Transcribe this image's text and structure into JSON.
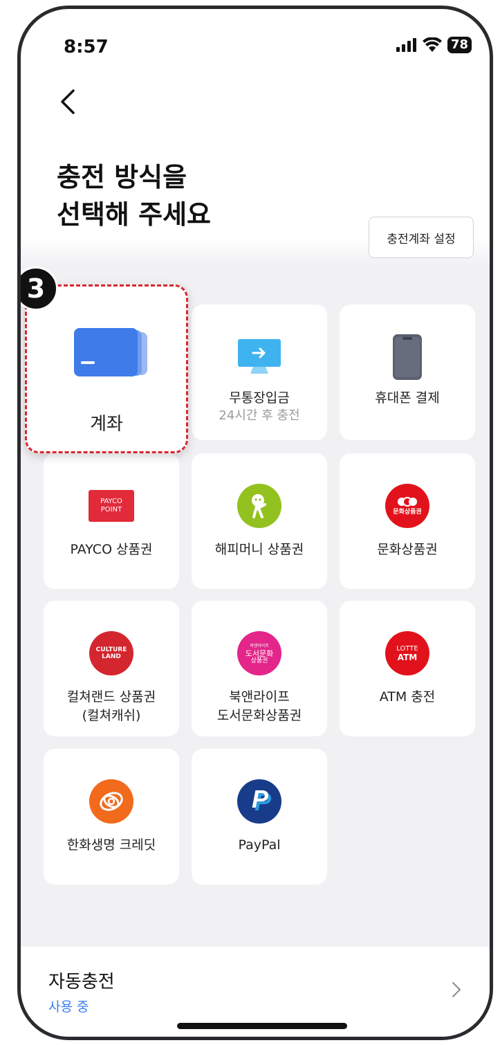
{
  "status": {
    "time": "8:57",
    "battery": "78"
  },
  "header": {
    "title_line1": "충전 방식을",
    "title_line2": "선택해 주세요",
    "account_setting_button": "충전계좌 설정"
  },
  "step_badge": "3",
  "tiles": {
    "account": {
      "label": "계좌"
    },
    "bank_transfer": {
      "label": "무통장입금",
      "sub": "24시간 후 충전"
    },
    "mobile_payment": {
      "label": "휴대폰 결제"
    },
    "payco": {
      "label": "PAYCO 상품권",
      "logo_line1": "PAYCO",
      "logo_line2": "POINT"
    },
    "happymoney": {
      "label": "해피머니 상품권"
    },
    "culture_gift": {
      "label": "문화상품권",
      "logo_text": "문화상품권"
    },
    "cultureland": {
      "label_line1": "컬쳐랜드 상품권",
      "label_line2": "(컬쳐캐쉬)",
      "logo_line1": "CULTURE",
      "logo_line2": "LAND"
    },
    "booknlife": {
      "label_line1": "북앤라이프",
      "label_line2": "도서문화상품권",
      "logo_line1": "북앤라이프",
      "logo_line2": "도서문화",
      "logo_line3": "상품권"
    },
    "atm": {
      "label": "ATM 충전",
      "logo_line1": "LOTTE",
      "logo_line2": "ATM"
    },
    "hanwha": {
      "label": "한화생명 크레딧"
    },
    "paypal": {
      "label": "PayPal"
    }
  },
  "auto_charge": {
    "title": "자동충전",
    "status": "사용 중"
  },
  "colors": {
    "accent_blue": "#3a7ff0",
    "highlight_red": "#d8262f",
    "background_grey": "#f1f1f4"
  }
}
